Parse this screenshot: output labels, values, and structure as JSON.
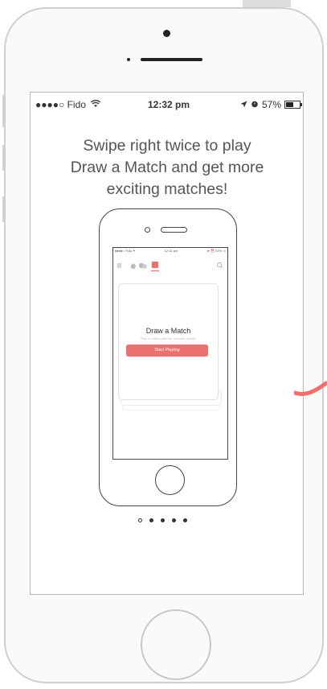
{
  "status_bar": {
    "carrier": "●●●●○ Fido",
    "wifi_icon": "wifi-icon",
    "time": "12:32 pm",
    "location_icon": "location-arrow-icon",
    "alarm_icon": "alarm-icon",
    "battery_percent": "57%",
    "battery_level": 0.57
  },
  "onboarding": {
    "headline_line1": "Swipe right twice to play",
    "headline_line2": "Draw a Match and get more",
    "headline_line3": "exciting matches!"
  },
  "mini_screen": {
    "status_left": "●●●●○ Fido ✦",
    "status_time": "12:32 pm",
    "status_right": "➤ ⏰ 57% ▭",
    "card_title": "Draw a Match",
    "card_subtitle": "Play to match with the cooolest people",
    "card_button": "Start Playing"
  },
  "pager": {
    "count": 5,
    "active_index": 0
  },
  "colors": {
    "accent": "#ef6e6e",
    "text": "#555555"
  }
}
